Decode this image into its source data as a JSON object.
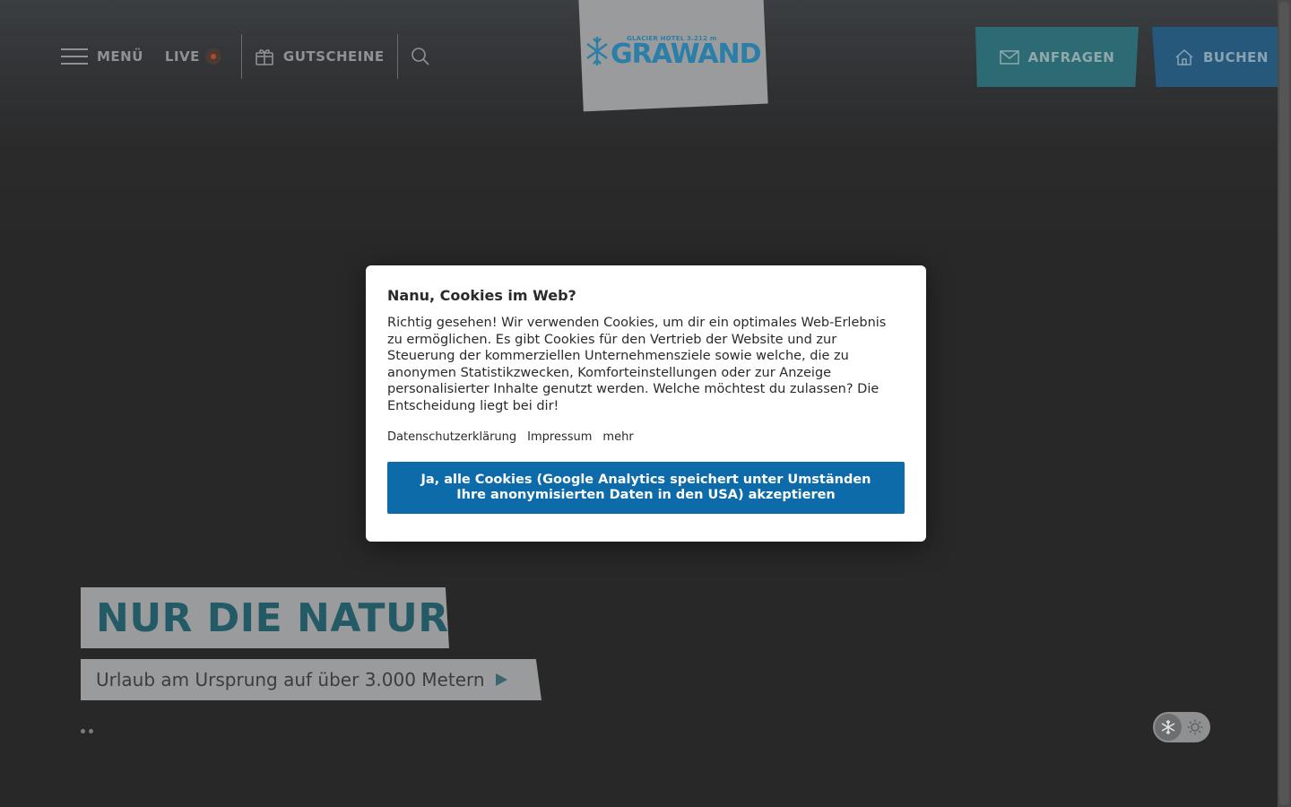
{
  "header": {
    "menu_label": "MENÜ",
    "live_label": "LIVE",
    "vouchers_label": "GUTSCHEINE",
    "logo": {
      "small_text": "GLACIER HOTEL 3.212 m",
      "brand": "GRAWAND"
    },
    "inquire_label": "ANFRAGEN",
    "book_label": "BUCHEN"
  },
  "hero": {
    "title": "NUR DIE NATUR",
    "subtitle": "Urlaub am Ursprung auf über 3.000 Metern",
    "slide_count": 2,
    "active_slide": 1
  },
  "season_toggle": {
    "options": [
      "snowflake-icon",
      "sun-icon"
    ],
    "active": "snowflake-icon"
  },
  "cookie_modal": {
    "title": "Nanu, Cookies im Web?",
    "text": "Richtig gesehen! Wir verwenden Cookies, um dir ein optimales Web-Erlebnis zu ermöglichen. Es gibt Cookies für den Vertrieb der Website und zur Steuerung der kommerziellen Unternehmensziele sowie welche, die zu anonymen Statistikzwecken, Komforteinstellungen oder zur Anzeige personalisierter Inhalte genutzt werden. Welche möchtest du zulassen? Die Entscheidung liegt bei dir!",
    "links": {
      "privacy": "Datenschutzerklärung",
      "imprint": "Impressum",
      "more": "mehr"
    },
    "accept_label": "Ja, alle Cookies (Google Analytics speichert unter Umständen Ihre anonymisierten Daten in den USA) akzeptieren"
  },
  "colors": {
    "accept_button": "#0c6ba8",
    "inquire_button": "#2c6a74",
    "book_button": "#25587a",
    "brand_blue": "#2a7ea8"
  }
}
